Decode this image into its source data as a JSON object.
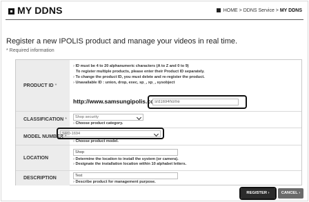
{
  "header": {
    "title": "MY DDNS",
    "breadcrumb": [
      "HOME",
      "DDNS Service",
      "MY DDNS"
    ],
    "breadcrumb_sep": ">"
  },
  "intro": {
    "headline": "Register a new IPOLIS product and manage your videos in real time.",
    "required_note": "* Required information"
  },
  "form": {
    "product_id": {
      "label": "PRODUCT ID",
      "required_mark": "*",
      "notes": [
        "ID must be 4 to 20 alphanumeric characters (A to Z and 0 to 9)",
        "To register multiple products, please enter their Product ID separately.",
        "To change the product ID, you must delete and re-register the product.",
        "Unavailable ID : union, drop, exec, sp_, xp_, sysobject"
      ],
      "url_prefix": "http://www.samsungipolis.com/",
      "value": "srd1694home"
    },
    "classification": {
      "label": "CLASSIFICATION",
      "required_mark": "*",
      "selected": "Shop security",
      "note": "Choose product category."
    },
    "model_number": {
      "label": "MODEL NUMBER",
      "required_mark": "*",
      "selected": "SRD-1694",
      "note": "Choose product model."
    },
    "location": {
      "label": "LOCATION",
      "value": "Shop",
      "notes": [
        "Determine the location to install the system (or camera).",
        "Designate the installation location within 10 alphabet letters."
      ]
    },
    "description": {
      "label": "DESCRIPTION",
      "value": "Test",
      "note": "Describe product for management purpose."
    }
  },
  "buttons": {
    "register": "REGISTER",
    "cancel": "CANCEL"
  },
  "icons": {
    "bullet": "›",
    "button_arrow": "›"
  }
}
